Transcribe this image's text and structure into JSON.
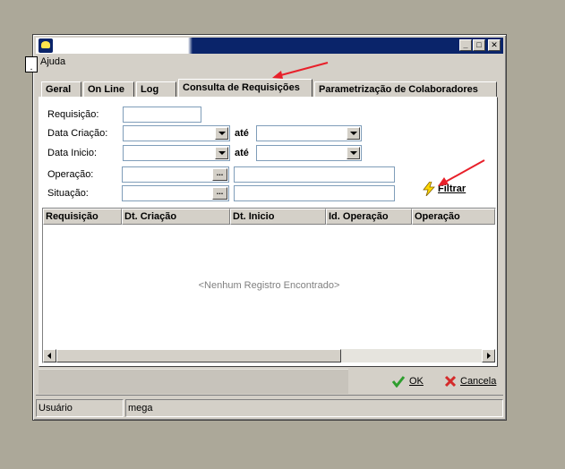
{
  "menu": {
    "help_label": "Ajuda",
    "dot_label": "."
  },
  "tabs": [
    {
      "label": "Geral"
    },
    {
      "label": "On Line"
    },
    {
      "label": "Log"
    },
    {
      "label": "Consulta de Requisições"
    },
    {
      "label": "Parametrização de Colaboradores"
    }
  ],
  "form": {
    "requisicao_label": "Requisição:",
    "data_criacao_label": "Data Criação:",
    "data_inicio_label": "Data Inicio:",
    "ate_label": "até",
    "operacao_label": "Operação:",
    "situacao_label": "Situação:",
    "filter_label": "Filtrar"
  },
  "grid": {
    "columns": [
      "Requisição",
      "Dt. Criação",
      "Dt. Inicio",
      "Id. Operação",
      "Operação"
    ],
    "empty_text": "<Nenhum Registro Encontrado>"
  },
  "buttons": {
    "ok_label": "OK",
    "cancel_label": "Cancela"
  },
  "status": {
    "user_label": "Usuário",
    "user_value": "mega"
  },
  "colors": {
    "titlebar": "#0a246a",
    "window": "#d4d0c8",
    "annotation_arrow": "#e8202a"
  }
}
